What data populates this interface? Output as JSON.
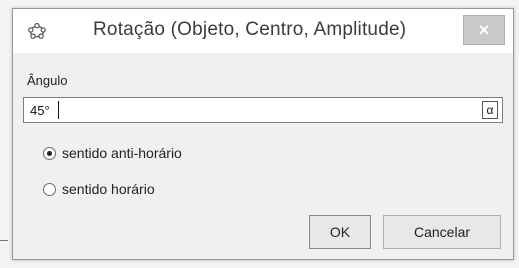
{
  "window": {
    "title": "Rotação (Objeto, Centro, Amplitude)",
    "app_icon": "geogebra-icon",
    "close_label": "×"
  },
  "form": {
    "angle_label": "Ângulo",
    "angle_value": "45°",
    "alpha_button_label": "α"
  },
  "direction": {
    "options": [
      {
        "label": "sentido anti-horário",
        "selected": true
      },
      {
        "label": "sentido horário",
        "selected": false
      }
    ]
  },
  "buttons": {
    "ok_label": "OK",
    "cancel_label": "Cancelar"
  }
}
